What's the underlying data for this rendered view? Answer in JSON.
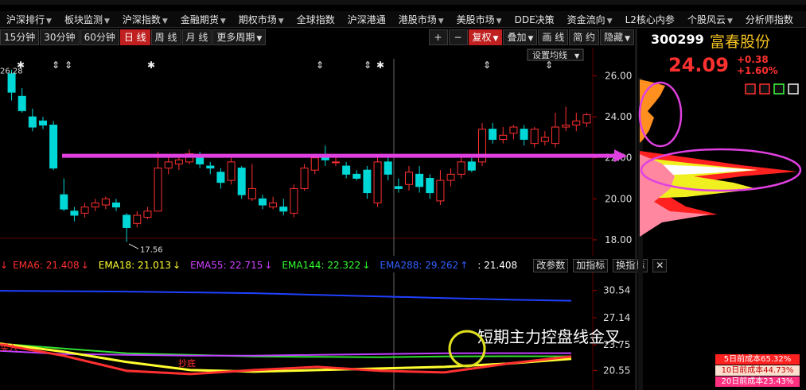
{
  "top_nav": [
    {
      "label": "沪深排行",
      "arrow": true
    },
    {
      "label": "板块监测",
      "arrow": true
    },
    {
      "label": "沪深指数",
      "arrow": true
    },
    {
      "label": "金融期货",
      "arrow": true
    },
    {
      "label": "期权市场",
      "arrow": true
    },
    {
      "label": "全球指数",
      "arrow": false
    },
    {
      "label": "沪深港通",
      "arrow": false
    },
    {
      "label": "港股市场",
      "arrow": true
    },
    {
      "label": "美股市场",
      "arrow": true
    },
    {
      "label": "DDE决策",
      "arrow": false
    },
    {
      "label": "资金流向",
      "arrow": true
    },
    {
      "label": "L2核心内参",
      "arrow": false
    },
    {
      "label": "个股风云",
      "arrow": true
    },
    {
      "label": "分析师指数",
      "arrow": false
    }
  ],
  "toolbar": {
    "periods": [
      "15分钟",
      "30分钟",
      "60分钟",
      "日 线",
      "周 线",
      "月 线",
      "更多周期"
    ],
    "active_period": "日 线",
    "more_arrow": "▼",
    "plus": "+",
    "minus": "−",
    "restore": "复权",
    "overlay": "叠加",
    "draw": "画 线",
    "simple": "简 约",
    "hide": "隐藏",
    "settings_ma": "设置均线"
  },
  "stock": {
    "code": "300299",
    "name": "富春股份",
    "price": "24.09",
    "change": "+0.38",
    "change_pct": "+1.60%"
  },
  "price_axis": [
    "26.00",
    "24.00",
    "22.00",
    "20.00",
    "18.00"
  ],
  "price_labels": {
    "high": "26.28",
    "low": "17.56"
  },
  "indicator": {
    "name_mark": "↓",
    "items": [
      {
        "label": "EMA6: 21.408",
        "arrow": "↓",
        "color": "#ff3030"
      },
      {
        "label": "EMA18: 21.013",
        "arrow": "↓",
        "color": "#ffff30"
      },
      {
        "label": "EMA55: 22.715",
        "arrow": "↓",
        "color": "#d040ff"
      },
      {
        "label": "EMA144: 22.322",
        "arrow": "↓",
        "color": "#30ff30"
      },
      {
        "label": "EMA288: 29.262",
        "arrow": "↑",
        "color": "#3060ff"
      },
      {
        "label": ": 21.408",
        "arrow": "",
        "color": "#ffffff"
      }
    ],
    "buttons": [
      "改参数",
      "加指标",
      "换指标",
      "✕"
    ],
    "axis": [
      "30.54",
      "27.14",
      "23.75",
      "20.55"
    ],
    "annotation": "短期主力控盘线金叉",
    "buy_label": "买入",
    "bottom_label": "抄底"
  },
  "cost_legend": [
    {
      "label": "5日前成本65.32%",
      "color": "#ff2020"
    },
    {
      "label": "10日前成本44.73%",
      "color": "#ffe0d0"
    },
    {
      "label": "20日前成本23.43%",
      "color": "#ff3080"
    }
  ],
  "chart_data": {
    "type": "candlestick",
    "ylim": [
      17.3,
      26.6
    ],
    "candles": [
      {
        "o": 26.1,
        "c": 25.2,
        "h": 26.3,
        "l": 24.8
      },
      {
        "o": 25.0,
        "c": 24.3,
        "h": 25.4,
        "l": 24.2
      },
      {
        "o": 24.0,
        "c": 23.5,
        "h": 24.4,
        "l": 23.3
      },
      {
        "o": 23.8,
        "c": 23.6,
        "h": 24.0,
        "l": 23.4
      },
      {
        "o": 23.6,
        "c": 21.5,
        "h": 23.8,
        "l": 21.4
      },
      {
        "o": 20.2,
        "c": 19.5,
        "h": 21.0,
        "l": 19.4
      },
      {
        "o": 19.4,
        "c": 19.2,
        "h": 19.6,
        "l": 18.9
      },
      {
        "o": 19.3,
        "c": 19.6,
        "h": 19.8,
        "l": 19.1
      },
      {
        "o": 19.6,
        "c": 19.8,
        "h": 20.0,
        "l": 19.4
      },
      {
        "o": 19.7,
        "c": 20.0,
        "h": 20.1,
        "l": 19.5
      },
      {
        "o": 19.8,
        "c": 19.6,
        "h": 20.0,
        "l": 19.4
      },
      {
        "o": 19.2,
        "c": 18.6,
        "h": 19.3,
        "l": 17.9
      },
      {
        "o": 18.8,
        "c": 19.2,
        "h": 19.4,
        "l": 18.6
      },
      {
        "o": 19.1,
        "c": 19.4,
        "h": 19.6,
        "l": 19.0
      },
      {
        "o": 19.4,
        "c": 21.5,
        "h": 22.3,
        "l": 19.4
      },
      {
        "o": 21.5,
        "c": 21.8,
        "h": 22.1,
        "l": 21.2
      },
      {
        "o": 21.7,
        "c": 21.9,
        "h": 22.1,
        "l": 21.4
      },
      {
        "o": 21.8,
        "c": 22.2,
        "h": 22.4,
        "l": 21.7
      },
      {
        "o": 22.1,
        "c": 21.7,
        "h": 22.3,
        "l": 21.5
      },
      {
        "o": 21.6,
        "c": 21.5,
        "h": 21.8,
        "l": 21.2
      },
      {
        "o": 21.3,
        "c": 20.8,
        "h": 21.5,
        "l": 20.5
      },
      {
        "o": 20.9,
        "c": 21.8,
        "h": 22.0,
        "l": 20.7
      },
      {
        "o": 21.5,
        "c": 20.2,
        "h": 21.6,
        "l": 20.0
      },
      {
        "o": 20.0,
        "c": 20.5,
        "h": 21.7,
        "l": 19.9
      },
      {
        "o": 20.0,
        "c": 19.7,
        "h": 20.2,
        "l": 19.5
      },
      {
        "o": 19.6,
        "c": 19.8,
        "h": 20.1,
        "l": 19.5
      },
      {
        "o": 19.6,
        "c": 19.4,
        "h": 20.0,
        "l": 19.2
      },
      {
        "o": 19.3,
        "c": 20.5,
        "h": 20.7,
        "l": 19.1
      },
      {
        "o": 20.5,
        "c": 21.5,
        "h": 21.7,
        "l": 20.4
      },
      {
        "o": 21.4,
        "c": 22.0,
        "h": 22.2,
        "l": 21.2
      },
      {
        "o": 22.0,
        "c": 21.9,
        "h": 22.6,
        "l": 21.6
      },
      {
        "o": 21.8,
        "c": 21.8,
        "h": 22.1,
        "l": 21.6
      },
      {
        "o": 21.6,
        "c": 21.2,
        "h": 21.8,
        "l": 21.0
      },
      {
        "o": 21.2,
        "c": 21.0,
        "h": 21.4,
        "l": 20.9
      },
      {
        "o": 21.4,
        "c": 20.3,
        "h": 21.6,
        "l": 20.0
      },
      {
        "o": 19.8,
        "c": 21.8,
        "h": 22.1,
        "l": 19.6
      },
      {
        "o": 21.8,
        "c": 21.2,
        "h": 22.1,
        "l": 20.9
      },
      {
        "o": 20.6,
        "c": 20.5,
        "h": 21.0,
        "l": 20.3
      },
      {
        "o": 20.7,
        "c": 21.3,
        "h": 21.6,
        "l": 20.4
      },
      {
        "o": 21.2,
        "c": 20.6,
        "h": 21.6,
        "l": 20.3
      },
      {
        "o": 21.0,
        "c": 20.3,
        "h": 21.2,
        "l": 20.0
      },
      {
        "o": 19.9,
        "c": 20.9,
        "h": 21.4,
        "l": 19.7
      },
      {
        "o": 20.9,
        "c": 21.2,
        "h": 21.5,
        "l": 20.6
      },
      {
        "o": 21.2,
        "c": 21.8,
        "h": 22.2,
        "l": 21.0
      },
      {
        "o": 21.8,
        "c": 21.4,
        "h": 22.0,
        "l": 21.3
      },
      {
        "o": 21.8,
        "c": 23.4,
        "h": 23.7,
        "l": 21.6
      },
      {
        "o": 23.4,
        "c": 22.9,
        "h": 23.7,
        "l": 22.7
      },
      {
        "o": 22.9,
        "c": 23.1,
        "h": 23.5,
        "l": 22.7
      },
      {
        "o": 23.2,
        "c": 23.5,
        "h": 23.6,
        "l": 22.9
      },
      {
        "o": 23.4,
        "c": 22.9,
        "h": 23.6,
        "l": 22.6
      },
      {
        "o": 22.7,
        "c": 23.4,
        "h": 23.5,
        "l": 22.5
      },
      {
        "o": 22.8,
        "c": 23.0,
        "h": 23.3,
        "l": 22.6
      },
      {
        "o": 22.7,
        "c": 23.5,
        "h": 24.2,
        "l": 22.5
      },
      {
        "o": 23.5,
        "c": 23.6,
        "h": 24.5,
        "l": 23.3
      },
      {
        "o": 23.6,
        "c": 23.8,
        "h": 24.2,
        "l": 23.3
      },
      {
        "o": 23.7,
        "c": 24.1,
        "h": 24.2,
        "l": 23.5
      }
    ],
    "highlight_level": 22.1,
    "ema_ylim": [
      19.3,
      32.0
    ],
    "ema_series": [
      {
        "name": "EMA288",
        "color": "#2040ff",
        "values": [
          30.5,
          30.45,
          30.4,
          30.3,
          30.2,
          30.0,
          29.8,
          29.6,
          29.4,
          29.262
        ]
      },
      {
        "name": "EMA144",
        "color": "#30e030",
        "values": [
          23.9,
          23.3,
          22.7,
          22.5,
          22.3,
          22.25,
          22.2,
          22.3,
          22.322,
          22.32
        ]
      },
      {
        "name": "EMA55",
        "color": "#c040ff",
        "values": [
          23.0,
          22.6,
          22.5,
          22.4,
          22.4,
          22.5,
          22.6,
          22.7,
          22.715,
          22.71
        ]
      },
      {
        "name": "EMA18",
        "color": "#ffff30",
        "values": [
          23.9,
          22.9,
          21.6,
          20.6,
          20.4,
          20.6,
          20.8,
          21.0,
          21.4,
          22.0
        ]
      },
      {
        "name": "EMA6",
        "color": "#ff3030",
        "values": [
          23.8,
          22.4,
          20.5,
          20.1,
          20.6,
          21.0,
          20.5,
          20.3,
          21.4,
          22.3
        ]
      }
    ]
  }
}
